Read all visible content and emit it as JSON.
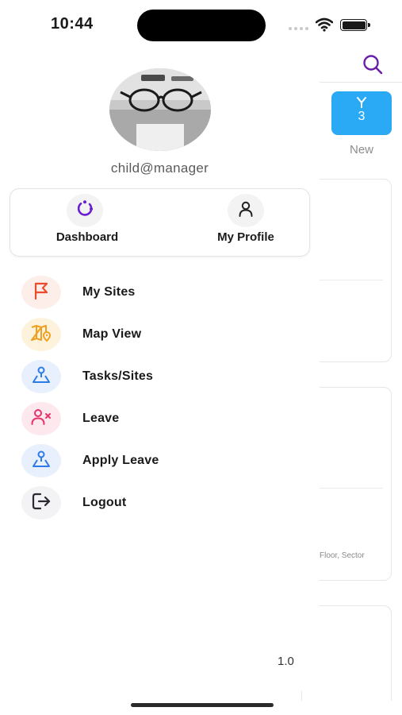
{
  "status_bar": {
    "time": "10:44",
    "icons": [
      "signal-dots-icon",
      "wifi-icon",
      "battery-icon"
    ]
  },
  "background_page": {
    "search_icon": "search-icon",
    "badge": {
      "icon": "branch-icon",
      "count": "3",
      "color": "#2aaaf5"
    },
    "new_label": "New",
    "partial_text": "Floor, Sector"
  },
  "drawer": {
    "avatar": "profile-photo-glasses",
    "email": "child@manager",
    "quick_actions": [
      {
        "label": "Dashboard",
        "icon": "dashboard-refresh-icon",
        "color": "#6a1fd1"
      },
      {
        "label": "My Profile",
        "icon": "user-icon",
        "color": "#222222"
      }
    ],
    "menu": [
      {
        "label": "My Sites",
        "icon": "flag-icon",
        "color": "#ef4a2e",
        "bg": "#fdeeea"
      },
      {
        "label": "Map View",
        "icon": "map-icon",
        "color": "#f0a020",
        "bg": "#fdf3dd"
      },
      {
        "label": "Tasks/Sites",
        "icon": "location-pin-icon",
        "color": "#2d7be5",
        "bg": "#e7f0fc"
      },
      {
        "label": "Leave",
        "icon": "user-remove-icon",
        "color": "#e8336b",
        "bg": "#fde8ee"
      },
      {
        "label": "Apply Leave",
        "icon": "location-pin-icon",
        "color": "#2d7be5",
        "bg": "#e7f0fc"
      },
      {
        "label": "Logout",
        "icon": "logout-icon",
        "color": "#2a2a35",
        "bg": "#f3f3f5"
      }
    ],
    "version": "1.0"
  }
}
